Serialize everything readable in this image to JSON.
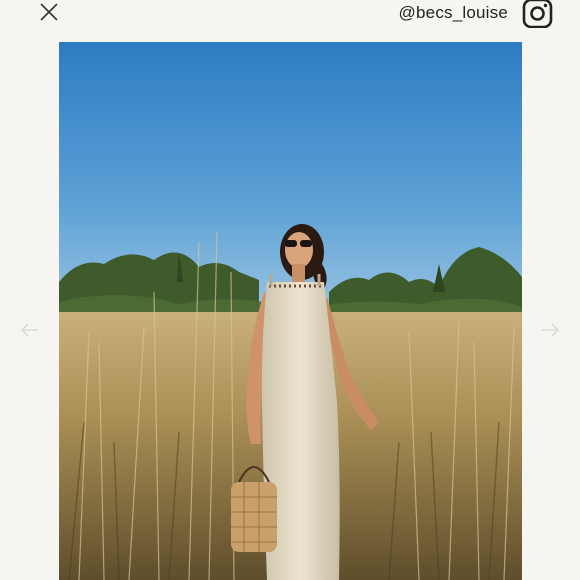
{
  "header": {
    "handle": "@becs_louise",
    "close_icon": "close-icon",
    "instagram_icon": "instagram-icon"
  },
  "navigation": {
    "prev_icon": "arrow-left-icon",
    "next_icon": "arrow-right-icon"
  },
  "colors": {
    "background": "#f7f5f2",
    "sky_top": "#2f7fc4",
    "sky_bottom": "#9fc6e0",
    "grass": "#b89a5a",
    "dress": "#e8e0cc"
  }
}
